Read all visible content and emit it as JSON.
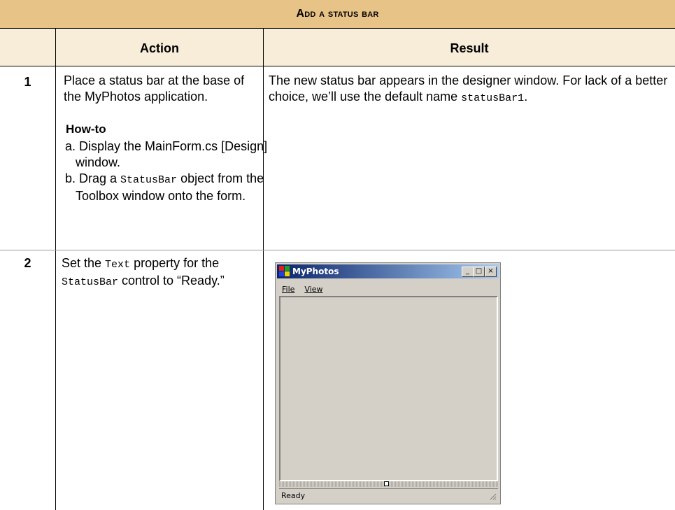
{
  "table": {
    "title": "Add a status bar",
    "headers": {
      "action": "Action",
      "result": "Result"
    },
    "rows": [
      {
        "number": "1",
        "action": "Place a status bar at the base of the MyPhotos application.",
        "howto_label": "How-to",
        "steps": [
          {
            "prefix": "a. ",
            "text": "Display the MainForm.cs [Design] window."
          },
          {
            "prefix": "b. Drag a ",
            "code": "StatusBar",
            "suffix": " object from the Toolbox window onto the form."
          }
        ],
        "result_text": "The new status bar appears in the designer window. For lack of a better choice, we’ll use the default name ",
        "result_code": "statusBar1",
        "result_end": "."
      },
      {
        "number": "2",
        "action_prefix": "Set the ",
        "action_code1": "Text",
        "action_mid": " property for the ",
        "action_code2": "StatusBar",
        "action_suffix": " control to “Ready.”"
      }
    ]
  },
  "screenshot": {
    "title": "MyPhotos",
    "menu": [
      "File",
      "View"
    ],
    "status_text": "Ready",
    "controls": {
      "minimize": "_",
      "maximize": "□",
      "close": "×"
    }
  }
}
